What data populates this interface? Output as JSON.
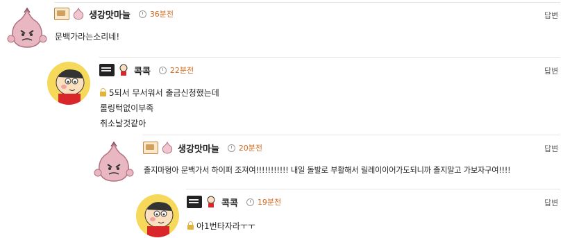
{
  "comments": [
    {
      "nickname": "생강맛마늘",
      "time": "36분전",
      "reply_label": "답변",
      "lines": [
        "문백가라는소리네!"
      ],
      "avatar": "garlic-character",
      "level_icon": "level-badge-icon",
      "emblem": "garlic-emblem-icon"
    },
    {
      "nickname": "콕콕",
      "time": "22분전",
      "reply_label": "답변",
      "lines": [
        "5되서 무서워서 출금신청했는데",
        "롤링턱없이부족",
        "취소날것같아"
      ],
      "secret": true,
      "avatar": "cartoon-boy-character",
      "level_icon": "level-badge-dark-icon",
      "emblem": "boy-emblem-icon"
    },
    {
      "nickname": "생강맛마늘",
      "time": "20분전",
      "reply_label": "답변",
      "lines": [
        "졸지마형아 문백가서 하이퍼 조져여!!!!!!!!!!! 내일 돌발로 부활해서 릴레이이어가도되니까 졸지말고 가보자구여!!!!"
      ],
      "avatar": "garlic-character",
      "level_icon": "level-badge-icon",
      "emblem": "garlic-emblem-icon"
    },
    {
      "nickname": "콕콕",
      "time": "19분전",
      "reply_label": "답변",
      "lines": [
        "아1번타자라ㅜㅜ"
      ],
      "secret": true,
      "avatar": "cartoon-boy-character",
      "level_icon": "level-badge-dark-icon",
      "emblem": "boy-emblem-icon"
    }
  ]
}
